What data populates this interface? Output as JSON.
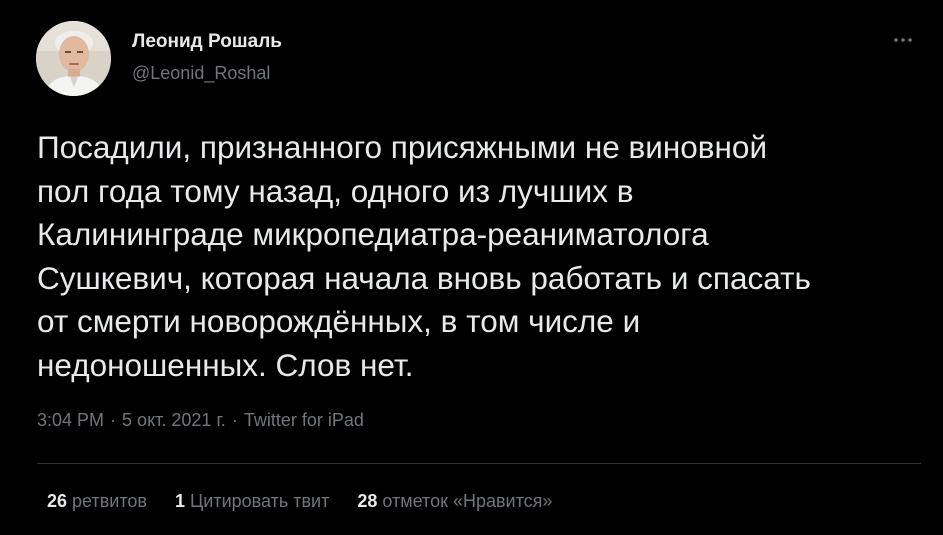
{
  "author": {
    "name": "Леонид Рошаль",
    "handle": "@Leonid_Roshal"
  },
  "tweet": {
    "lines": [
      "Посадили, признанного присяжными не виновной",
      "пол года тому назад, одного из лучших в",
      "Калининграде микропедиатра-реаниматолога",
      "Сушкевич, которая начала вновь работать и спасать",
      "от смерти новорождённых, в том числе и",
      "недоношенных. Слов нет."
    ],
    "time": "3:04 PM",
    "date": "5 окт. 2021 г.",
    "separator": "·",
    "source": "Twitter for iPad"
  },
  "stats": {
    "retweets_count": "26",
    "retweets_label": "ретвитов",
    "quotes_count": "1",
    "quotes_label": "Цитировать твит",
    "likes_count": "28",
    "likes_label": "отметок «Нравится»"
  },
  "icons": {
    "more": "more-horizontal-icon",
    "avatar": "avatar-photo"
  },
  "colors": {
    "background": "#000000",
    "primary_text": "#e7e9ea",
    "secondary_text": "#71767b",
    "divider": "#2f3336"
  }
}
